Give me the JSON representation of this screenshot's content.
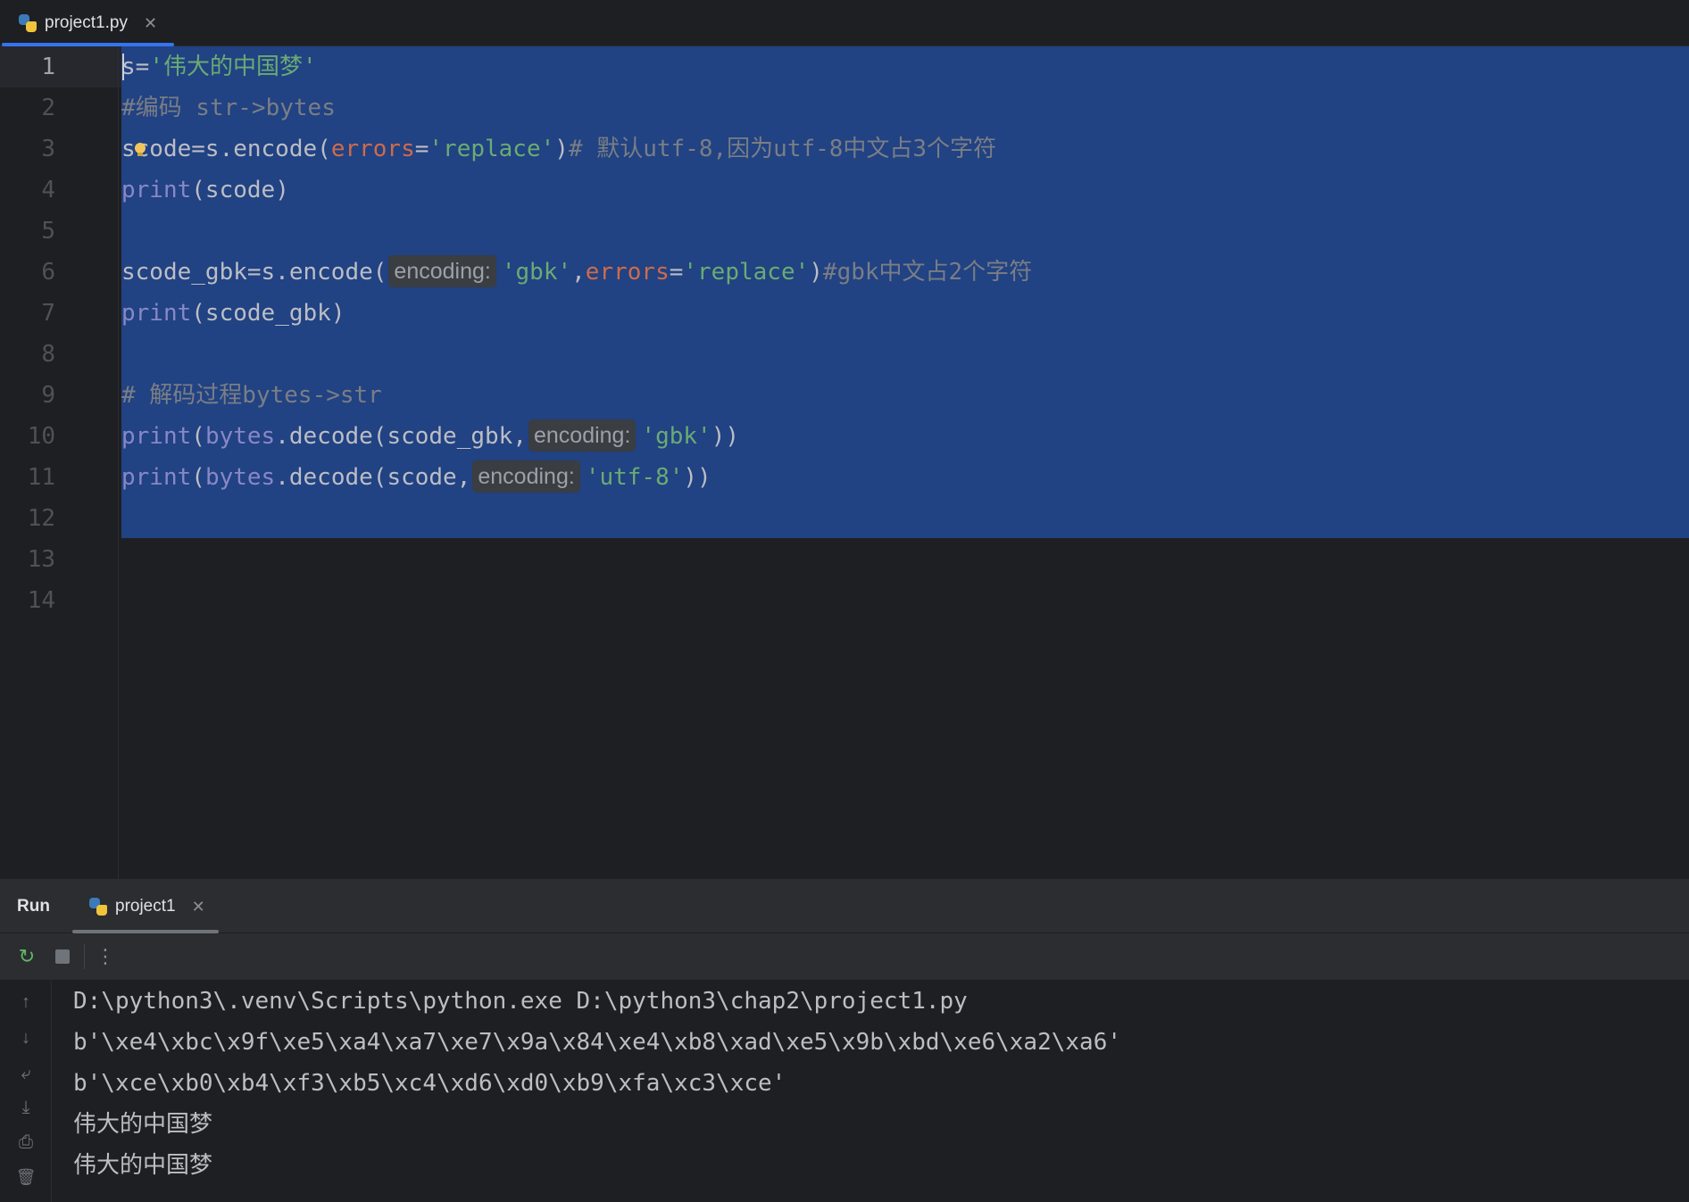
{
  "editor_tab": {
    "label": "project1.py",
    "close_glyph": "✕",
    "icon": "python-file-icon"
  },
  "line_numbers": [
    "1",
    "2",
    "3",
    "4",
    "5",
    "6",
    "7",
    "8",
    "9",
    "10",
    "11",
    "12",
    "13",
    "14"
  ],
  "code": {
    "l1": {
      "a": "s=",
      "b": "'伟大的中国梦'"
    },
    "l2": {
      "a": "#",
      "b": "编码 str->bytes"
    },
    "l3": {
      "a": "scode=s.encode(",
      "b": "errors",
      "c": "=",
      "d": "'replace'",
      "e": ")",
      "f": "# 默认utf-8,因为utf-8中文占3个字符"
    },
    "l4": {
      "a": "print",
      "b": "(scode)"
    },
    "l6": {
      "a": "scode_gbk=s.encode(",
      "hint": "encoding:",
      "b": "'gbk'",
      "c": ",",
      "d": "errors",
      "e": "=",
      "f": "'replace'",
      "g": ")",
      "h": "#gbk中文占2个字符"
    },
    "l7": {
      "a": "print",
      "b": "(scode_gbk)"
    },
    "l9": {
      "a": "# 解码过程bytes->str"
    },
    "l10": {
      "a": "print",
      "b": "(",
      "c": "bytes",
      "d": ".decode(scode_gbk,",
      "hint": "encoding:",
      "e": "'gbk'",
      "f": "))"
    },
    "l11": {
      "a": "print",
      "b": "(",
      "c": "bytes",
      "d": ".decode(scode,",
      "hint": "encoding:",
      "e": "'utf-8'",
      "f": "))"
    }
  },
  "run_panel": {
    "title": "Run",
    "tab_label": "project1",
    "close_glyph": "✕",
    "toolbar": {
      "rerun": "↻",
      "more": "⋮"
    },
    "side": {
      "up": "↑",
      "down": "↓",
      "wrap": "⤶",
      "scroll_end": "⤓",
      "print": "⎙",
      "clear": "🗑"
    },
    "output": [
      "D:\\python3\\.venv\\Scripts\\python.exe D:\\python3\\chap2\\project1.py",
      "b'\\xe4\\xbc\\x9f\\xe5\\xa4\\xa7\\xe7\\x9a\\x84\\xe4\\xb8\\xad\\xe5\\x9b\\xbd\\xe6\\xa2\\xa6'",
      "b'\\xce\\xb0\\xb4\\xf3\\xb5\\xc4\\xd6\\xd0\\xb9\\xfa\\xc3\\xce'",
      "伟大的中国梦",
      "伟大的中国梦"
    ]
  },
  "colors": {
    "selection": "#214283",
    "accent": "#3574f0",
    "string": "#6aab73",
    "keyword": "#8888c6",
    "param": "#cf6b4a",
    "comment": "#7a7e85"
  }
}
